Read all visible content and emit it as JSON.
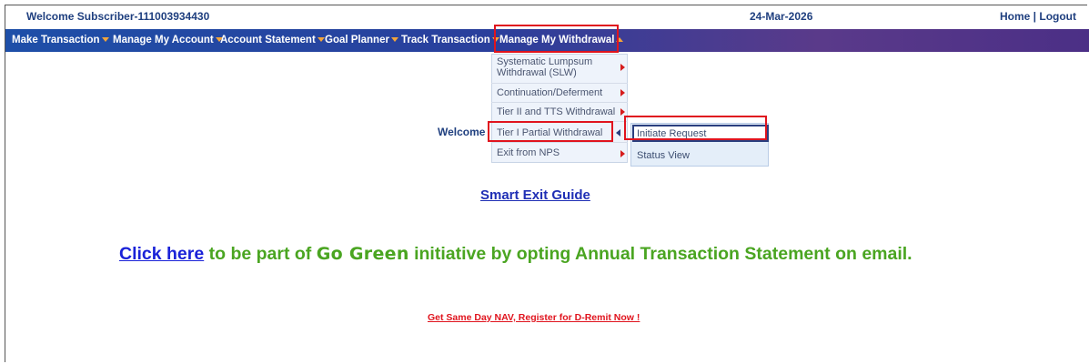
{
  "header": {
    "welcome": "Welcome Subscriber-111003934430",
    "date": "24-Mar-2026",
    "home_logout": "Home | Logout"
  },
  "nav": {
    "items": [
      {
        "label": "Make Transaction"
      },
      {
        "label": "Manage My Account"
      },
      {
        "label": "Account Statement"
      },
      {
        "label": "Goal Planner"
      },
      {
        "label": "Track Transaction"
      },
      {
        "label": "Manage My Withdrawal"
      }
    ]
  },
  "withdrawal_menu": {
    "items": [
      {
        "label": "Systematic Lumpsum Withdrawal (SLW)"
      },
      {
        "label": "Continuation/Deferment"
      },
      {
        "label": "Tier II and TTS Withdrawal"
      },
      {
        "label": "Tier I Partial Withdrawal"
      },
      {
        "label": "Exit from NPS"
      }
    ]
  },
  "submenu": {
    "items": [
      {
        "label": "Initiate Request"
      },
      {
        "label": "Status View"
      }
    ]
  },
  "main": {
    "welcome": "Welcome",
    "smart_exit": "Smart Exit Guide",
    "click_here": "Click here",
    "gogreen_pre": " to be part of ",
    "gogreen_brand": "Go Green",
    "gogreen_post": " initiative by opting Annual Transaction Statement on email.",
    "dremit": "Get Same Day NAV, Register for D-Remit Now !"
  },
  "colors": {
    "highlight": "#e0141e",
    "nav_blue": "#1e4fa8",
    "green": "#4aa521"
  }
}
